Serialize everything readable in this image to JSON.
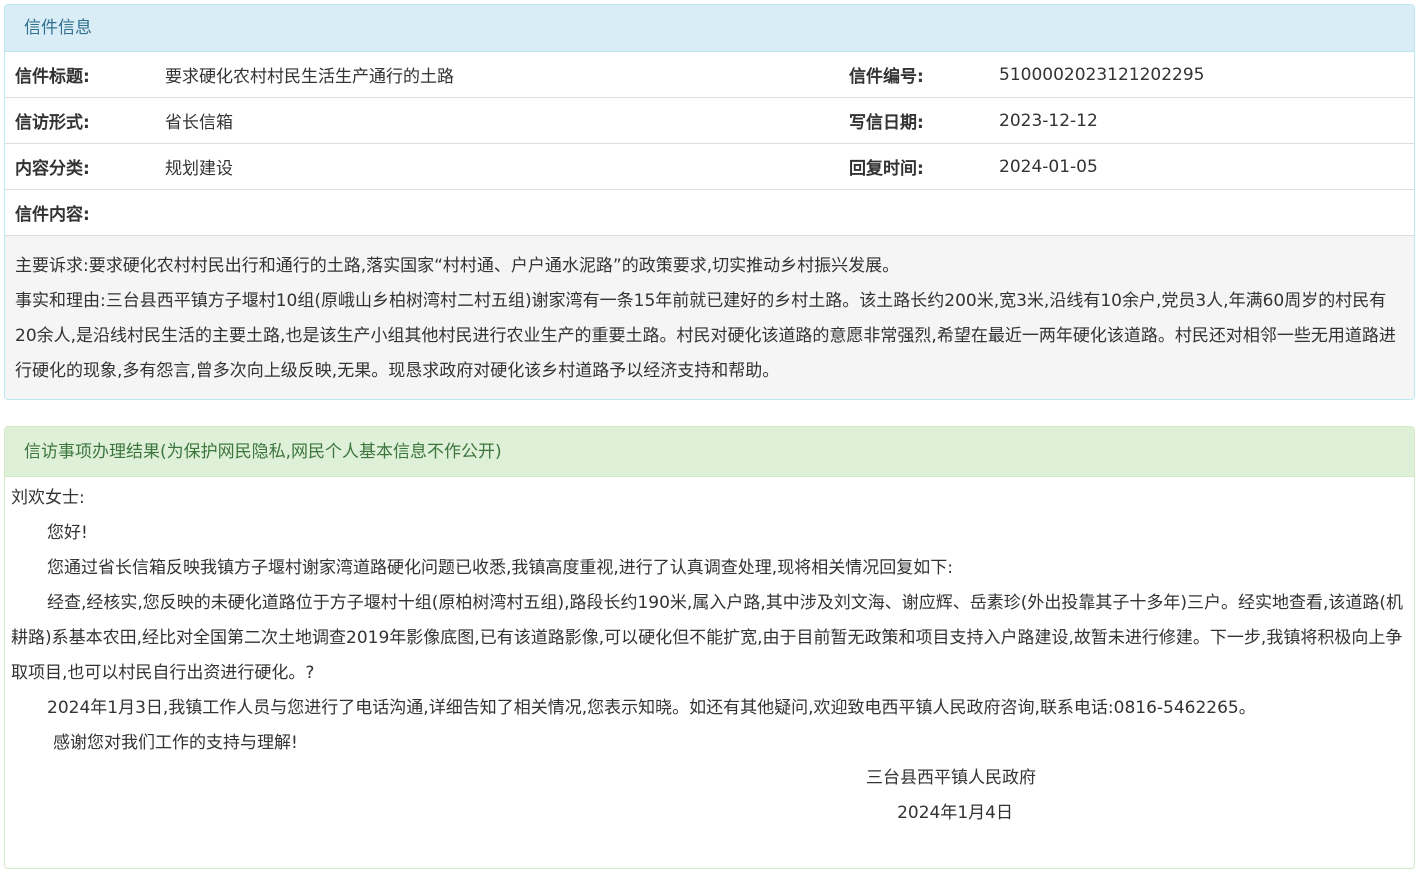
{
  "letter_panel": {
    "heading": "信件信息",
    "rows": [
      {
        "label1": "信件标题:",
        "value1": "要求硬化农村村民生活生产通行的土路",
        "label2": "信件编号:",
        "value2": "5100002023121202295"
      },
      {
        "label1": "信访形式:",
        "value1": "省长信箱",
        "label2": "写信日期:",
        "value2": "2023-12-12"
      },
      {
        "label1": "内容分类:",
        "value1": "规划建设",
        "label2": "回复时间:",
        "value2": "2024-01-05"
      }
    ],
    "content_label": "信件内容:",
    "content_paragraphs": [
      "主要诉求:要求硬化农村村民出行和通行的土路,落实国家“村村通、户户通水泥路”的政策要求,切实推动乡村振兴发展。",
      "事实和理由:三台县西平镇方子堰村10组(原峨山乡柏树湾村二村五组)谢家湾有一条15年前就已建好的乡村土路。该土路长约200米,宽3米,沿线有10余户,党员3人,年满60周岁的村民有20余人,是沿线村民生活的主要土路,也是该生产小组其他村民进行农业生产的重要土路。村民对硬化该道路的意愿非常强烈,希望在最近一两年硬化该道路。村民还对相邻一些无用道路进行硬化的现象,多有怨言,曾多次向上级反映,无果。现恳求政府对硬化该乡村道路予以经济支持和帮助。"
    ]
  },
  "reply_panel": {
    "heading": "信访事项办理结果(为保护网民隐私,网民个人基本信息不作公开)",
    "salutation": "刘欢女士:",
    "greeting": "您好!",
    "paragraphs": [
      "您通过省长信箱反映我镇方子堰村谢家湾道路硬化问题已收悉,我镇高度重视,进行了认真调查处理,现将相关情况回复如下:",
      "经查,经核实,您反映的未硬化道路位于方子堰村十组(原柏树湾村五组),路段长约190米,属入户路,其中涉及刘文海、谢应辉、岳素珍(外出投靠其子十多年)三户。经实地查看,该道路(机耕路)系基本农田,经比对全国第二次土地调查2019年影像底图,已有该道路影像,可以硬化但不能扩宽,由于目前暂无政策和项目支持入户路建设,故暂未进行修建。下一步,我镇将积极向上争取项目,也可以村民自行出资进行硬化。?",
      "2024年1月3日,我镇工作人员与您进行了电话沟通,详细告知了相关情况,您表示知晓。如还有其他疑问,欢迎致电西平镇人民政府咨询,联系电话:0816-5462265。"
    ],
    "thanks": "感谢您对我们工作的支持与理解!",
    "signature_org": "三台县西平镇人民政府",
    "signature_date": "2024年1月4日"
  }
}
